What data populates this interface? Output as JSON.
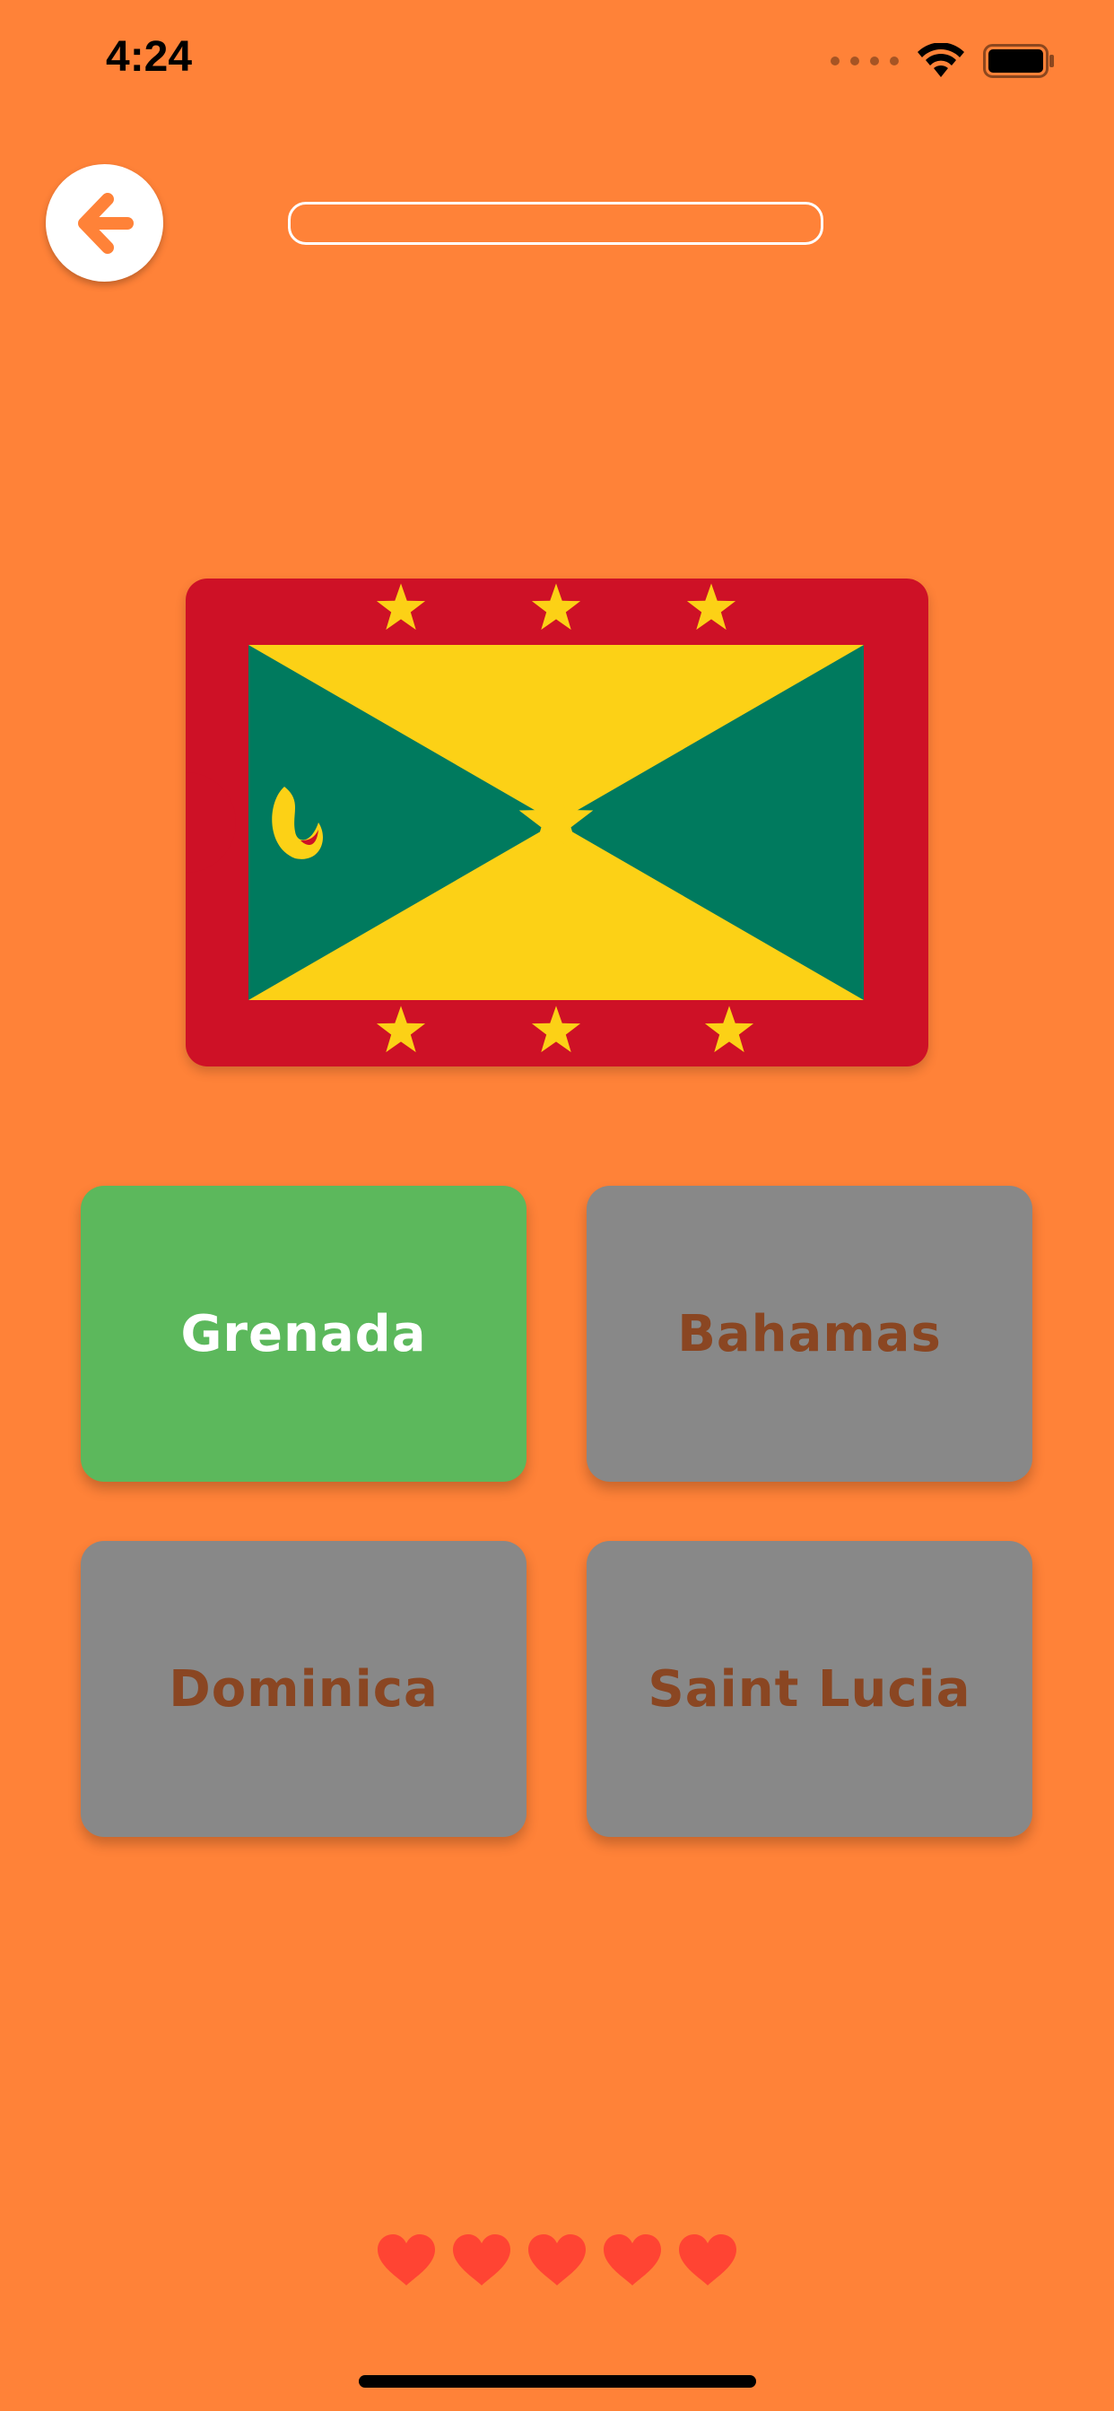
{
  "theme": {
    "background": "#FF8238",
    "correct_color": "#5CB85C",
    "neutral_color": "#888888",
    "correct_text_color": "#FFFFFF",
    "neutral_text_color": "#8A4622",
    "heart_color": "#FF4433"
  },
  "status_bar": {
    "time": "4:24",
    "icons": [
      "signal-dots-icon",
      "wifi-icon",
      "battery-icon"
    ]
  },
  "header": {
    "back_icon": "arrow-left-icon",
    "progress": 0
  },
  "question": {
    "flag": "grenada-flag"
  },
  "answers": [
    {
      "label": "Grenada",
      "state": "correct"
    },
    {
      "label": "Bahamas",
      "state": "neutral"
    },
    {
      "label": "Dominica",
      "state": "neutral"
    },
    {
      "label": "Saint Lucia",
      "state": "neutral"
    }
  ],
  "lives": {
    "remaining": 5,
    "total": 5
  }
}
